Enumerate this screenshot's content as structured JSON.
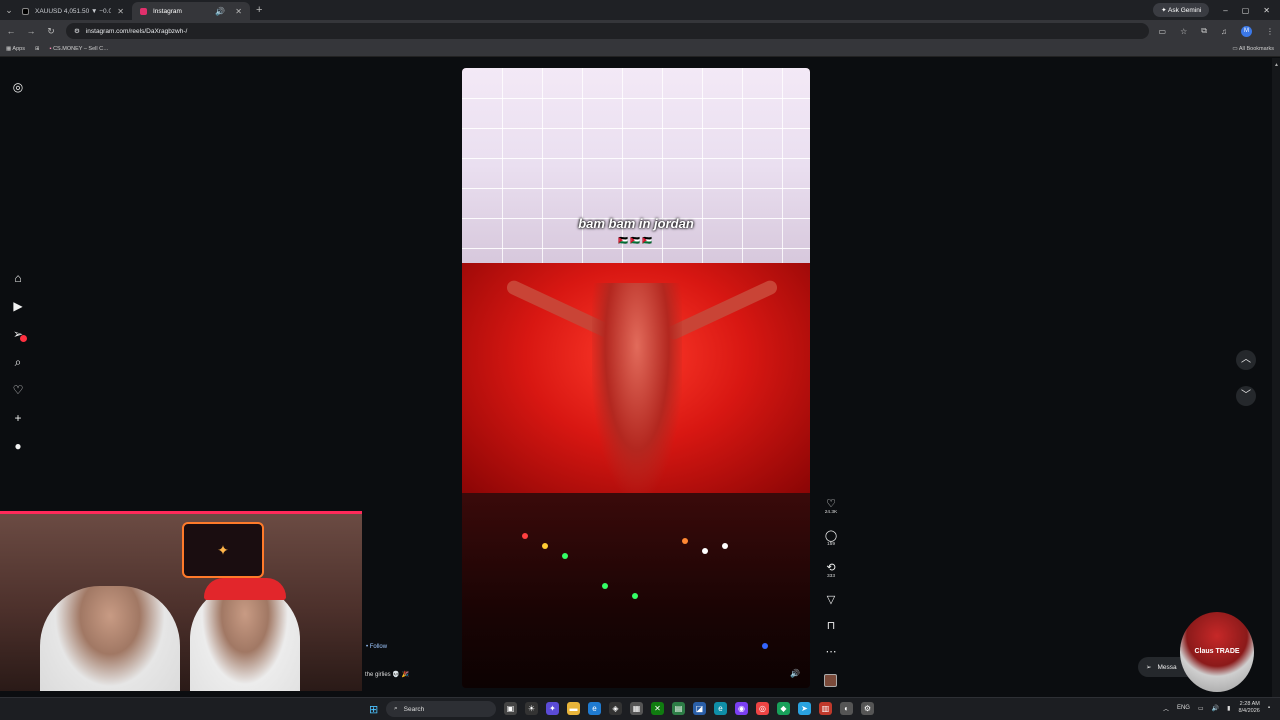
{
  "browser": {
    "tabs": [
      {
        "title": "XAUUSD 4,051.50 ▼ −0.09% C…",
        "favicon_color": "#000000",
        "active": false
      },
      {
        "title": "Instagram",
        "favicon_color": "#e1306c",
        "active": true
      }
    ],
    "ask_gemini": "Ask Gemini",
    "url": "instagram.com/reels/DaXragbzwh-/",
    "bookmarks": {
      "apps": "Apps",
      "item1": "CS.MONEY – Sell C…",
      "all": "All Bookmarks"
    },
    "profile_initial": "M"
  },
  "sidebar": {
    "items": [
      "instagram-logo",
      "home",
      "reels",
      "messages",
      "search",
      "notifications",
      "create",
      "profile"
    ],
    "messages_badge": "1"
  },
  "reel": {
    "caption": "bam bam in jordan",
    "flags": "🇯🇴🇯🇴🇯🇴"
  },
  "actions": {
    "like_count": "24.3K",
    "comment_count": "159",
    "repost_count": "333"
  },
  "post": {
    "follow": "• Follow",
    "caption_text": "the girlies 💀 🎉"
  },
  "messages_button": "Messa",
  "badge_text": "Claus TRADE",
  "taskbar": {
    "search_placeholder": "Search",
    "language": "ENG",
    "time": "2:28 AM",
    "date": "8/4/2026"
  }
}
